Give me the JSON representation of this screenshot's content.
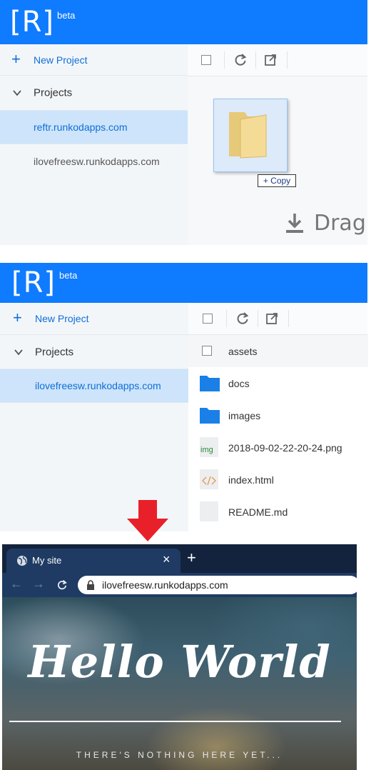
{
  "app": {
    "logo": "[R]",
    "beta": "beta"
  },
  "panel1": {
    "new_project": "New Project",
    "projects": "Projects",
    "items": [
      "reftr.runkodapps.com",
      "ilovefreesw.runkodapps.com"
    ],
    "copy_badge": "+ Copy",
    "drag_text": "Drag"
  },
  "panel2": {
    "new_project": "New Project",
    "projects": "Projects",
    "items": [
      "ilovefreesw.runkodapps.com"
    ],
    "files": [
      {
        "name": "assets",
        "icon": "checkbox"
      },
      {
        "name": "docs",
        "icon": "folder-icon"
      },
      {
        "name": "images",
        "icon": "folder-icon"
      },
      {
        "name": "2018-09-02-22-20-24.png",
        "icon": "image-file-icon"
      },
      {
        "name": "index.html",
        "icon": "code-file-icon"
      },
      {
        "name": "README.md",
        "icon": "file-icon"
      }
    ]
  },
  "browser": {
    "tab_title": "My site",
    "url": "ilovefreesw.runkodapps.com",
    "heading": "Hello World",
    "tagline": "THERE'S NOTHING HERE YET..."
  },
  "image_file_label": "img",
  "colors": {
    "brand": "#0f7bff",
    "selected": "#cde4fb",
    "arrow": "#e8202a",
    "folder": "#1a7fe6"
  }
}
